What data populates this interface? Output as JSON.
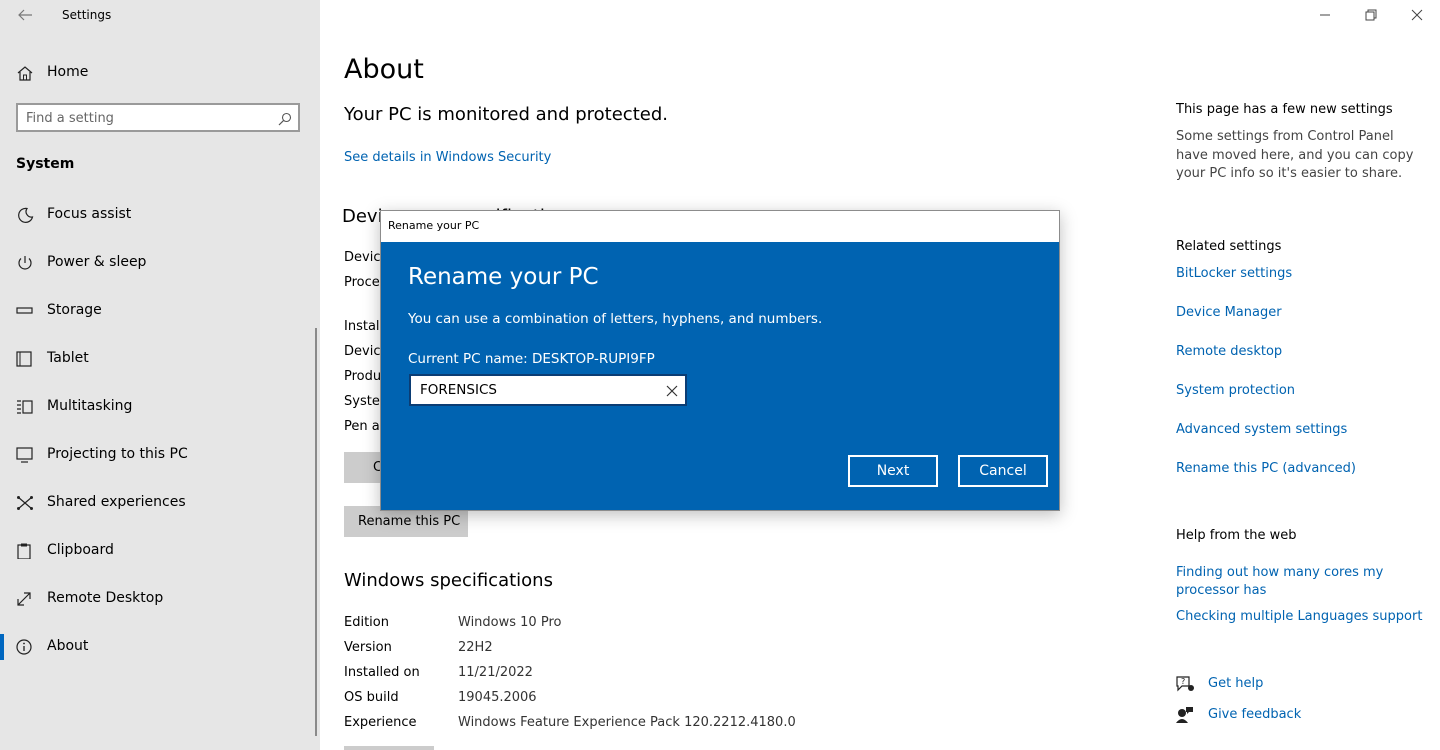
{
  "app": {
    "title": "Settings"
  },
  "sidebar": {
    "home_label": "Home",
    "search_placeholder": "Find a setting",
    "section": "System",
    "items": [
      {
        "label": "Focus assist",
        "icon": "moon-icon"
      },
      {
        "label": "Power & sleep",
        "icon": "power-icon"
      },
      {
        "label": "Storage",
        "icon": "storage-icon"
      },
      {
        "label": "Tablet",
        "icon": "tablet-icon"
      },
      {
        "label": "Multitasking",
        "icon": "multitasking-icon"
      },
      {
        "label": "Projecting to this PC",
        "icon": "projecting-icon"
      },
      {
        "label": "Shared experiences",
        "icon": "shared-icon"
      },
      {
        "label": "Clipboard",
        "icon": "clipboard-icon"
      },
      {
        "label": "Remote Desktop",
        "icon": "remote-icon"
      },
      {
        "label": "About",
        "icon": "info-icon",
        "active": true
      }
    ]
  },
  "main": {
    "title": "About",
    "security_status": "Your PC is monitored and protected.",
    "security_link": "See details in Windows Security",
    "device_specs_title_partial": "Devi",
    "device_specs_title_tail": "ecificati",
    "spec_labels_partial": [
      "Device",
      "Proce",
      "Install",
      "Device",
      "Produ",
      "Syster",
      "Pen ar"
    ],
    "copy_button_partial": "C",
    "rename_button": "Rename this PC",
    "windows_specs": {
      "title": "Windows specifications",
      "rows": [
        {
          "label": "Edition",
          "value": "Windows 10 Pro"
        },
        {
          "label": "Version",
          "value": "22H2"
        },
        {
          "label": "Installed on",
          "value": "11/21/2022"
        },
        {
          "label": "OS build",
          "value": "19045.2006"
        },
        {
          "label": "Experience",
          "value": "Windows Feature Experience Pack 120.2212.4180.0"
        }
      ]
    }
  },
  "right": {
    "new_settings_title": "This page has a few new settings",
    "new_settings_text": "Some settings from Control Panel have moved here, and you can copy your PC info so it's easier to share.",
    "related_title": "Related settings",
    "related_links": [
      "BitLocker settings",
      "Device Manager",
      "Remote desktop",
      "System protection",
      "Advanced system settings",
      "Rename this PC (advanced)"
    ],
    "help_title": "Help from the web",
    "help_links": [
      "Finding out how many cores my processor has",
      "Checking multiple Languages support"
    ],
    "get_help": "Get help",
    "give_feedback": "Give feedback"
  },
  "dialog": {
    "window_title": "Rename your PC",
    "heading": "Rename your PC",
    "description": "You can use a combination of letters, hyphens, and numbers.",
    "current_name": "Current PC name: DESKTOP-RUPI9FP",
    "input_value": "FORENSICS",
    "next_label": "Next",
    "cancel_label": "Cancel",
    "accent_color": "#0063b1"
  }
}
